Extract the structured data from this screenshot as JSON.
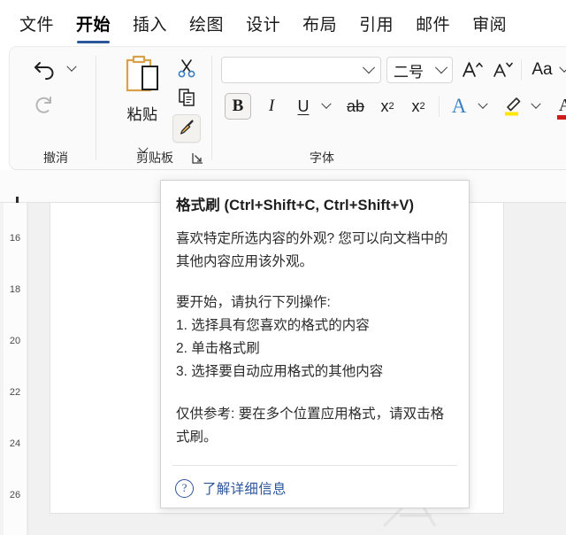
{
  "tabs": [
    {
      "label": "文件",
      "active": false
    },
    {
      "label": "开始",
      "active": true
    },
    {
      "label": "插入",
      "active": false
    },
    {
      "label": "绘图",
      "active": false
    },
    {
      "label": "设计",
      "active": false
    },
    {
      "label": "布局",
      "active": false
    },
    {
      "label": "引用",
      "active": false
    },
    {
      "label": "邮件",
      "active": false
    },
    {
      "label": "审阅",
      "active": false
    }
  ],
  "ribbon": {
    "accent_color": "#2b579a",
    "undo_group": {
      "label": "撤消",
      "undo_icon": "undo-arrow-icon",
      "undo_dropdown_icon": "chevron-down-icon",
      "redo_icon": "redo-arrow-icon"
    },
    "clipboard_group": {
      "label": "剪贴板",
      "paste_label": "粘贴",
      "paste_icon": "clipboard-icon",
      "paste_dropdown_icon": "chevron-down-icon",
      "cut_icon": "scissors-icon",
      "copy_icon": "copy-icon",
      "format_painter_icon": "paintbrush-icon",
      "launcher_icon": "dialog-launcher-icon"
    },
    "font_group": {
      "label": "字体",
      "font_name_value": "",
      "font_name_placeholder": "",
      "font_size_value": "二号",
      "grow_font_icon": "increase-font-size-icon",
      "shrink_font_icon": "decrease-font-size-icon",
      "change_case_label": "Aa",
      "bold_label": "B",
      "italic_label": "I",
      "underline_label": "U",
      "strikethrough_label": "ab",
      "subscript_label": "x",
      "subscript_sub": "2",
      "superscript_label": "x",
      "superscript_sup": "2",
      "text_effects_label": "A",
      "highlight_icon": "highlighter-icon",
      "font_color_label": "A",
      "bold_active": true
    }
  },
  "document": {
    "tab_stop_marker": "left-tab-stop",
    "vertical_ruler_marks": [
      "16",
      "18",
      "20",
      "22",
      "24",
      "26"
    ]
  },
  "tooltip": {
    "title": "格式刷 (Ctrl+Shift+C, Ctrl+Shift+V)",
    "description": "喜欢特定所选内容的外观? 您可以向文档中的其他内容应用该外观。",
    "steps_intro": "要开始，请执行下列操作:",
    "steps": [
      "1. 选择具有您喜欢的格式的内容",
      "2. 单击格式刷",
      "3. 选择要自动应用格式的其他内容"
    ],
    "note": "仅供参考: 要在多个位置应用格式，请双击格式刷。",
    "learn_more_label": "了解详细信息",
    "learn_more_icon": "help-question-icon",
    "link_color": "#2b579a"
  }
}
